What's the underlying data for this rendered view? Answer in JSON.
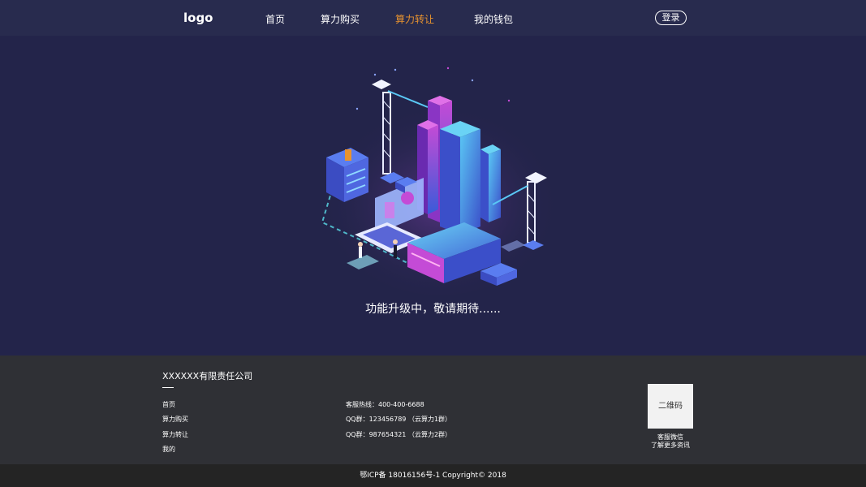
{
  "header": {
    "logo": "logo",
    "nav": [
      "首页",
      "算力购买",
      "算力转让",
      "我的钱包"
    ],
    "active_index": 2,
    "login_label": "登录"
  },
  "main": {
    "status_message": "功能升级中，敬请期待......"
  },
  "footer": {
    "company": "XXXXXX有限责任公司",
    "links": [
      "首页",
      "算力购买",
      "算力转让",
      "我的"
    ],
    "contacts": [
      "客服热线：400-400-6688",
      "QQ群：123456789 （云算力1群）",
      "QQ群：987654321 （云算力2群）"
    ],
    "qr_label": "二维码",
    "qr_caption_1": "客服微信",
    "qr_caption_2": "了解更多资讯"
  },
  "bottom": {
    "icp": "鄂ICP备 18016156号-1 Copyright© 2018"
  },
  "colors": {
    "active_nav": "#e8932f",
    "header_bg": "#282b4e",
    "main_bg": "#23244a",
    "footer_bg": "#2f3035"
  }
}
